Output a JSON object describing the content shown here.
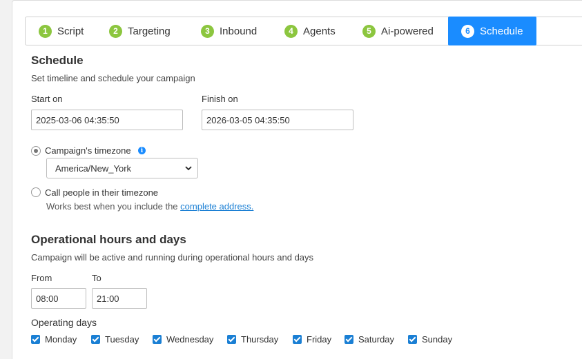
{
  "tabs": [
    {
      "num": "1",
      "label": "Script"
    },
    {
      "num": "2",
      "label": "Targeting"
    },
    {
      "num": "3",
      "label": "Inbound"
    },
    {
      "num": "4",
      "label": "Agents"
    },
    {
      "num": "5",
      "label": "Ai-powered"
    },
    {
      "num": "6",
      "label": "Schedule",
      "active": true
    }
  ],
  "schedule": {
    "title": "Schedule",
    "subtitle": "Set timeline and schedule your campaign",
    "start_label": "Start on",
    "start_value": "2025-03-06 04:35:50",
    "finish_label": "Finish on",
    "finish_value": "2026-03-05 04:35:50"
  },
  "timezone": {
    "campaign_label": "Campaign's timezone",
    "campaign_selected": true,
    "selected_value": "America/New_York",
    "people_label": "Call people in their timezone",
    "people_hint": "Works best when you include the",
    "people_link": "complete address."
  },
  "operational": {
    "title": "Operational hours and days",
    "subtitle": "Campaign will be active and running during operational hours and days",
    "from_label": "From",
    "from_value": "08:00",
    "to_label": "To",
    "to_value": "21:00",
    "days_label": "Operating days",
    "days": [
      "Monday",
      "Tuesday",
      "Wednesday",
      "Thursday",
      "Friday",
      "Saturday",
      "Sunday"
    ]
  },
  "colors": {
    "accent": "#1a8cff",
    "step_badge": "#8cc63f",
    "checkbox": "#1a7fd4"
  }
}
